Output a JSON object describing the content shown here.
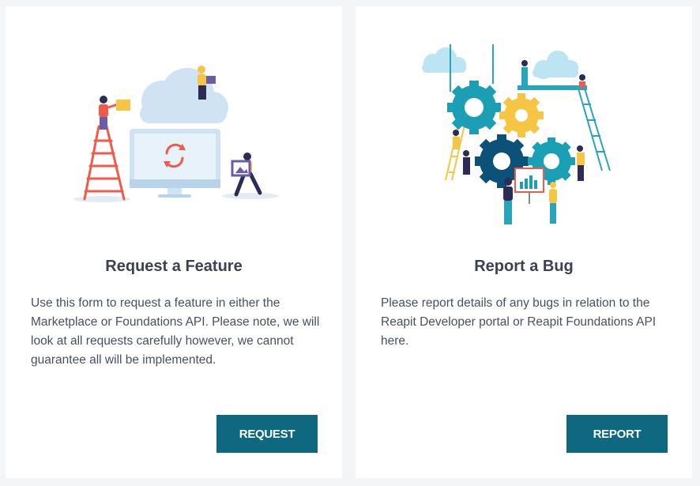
{
  "cards": [
    {
      "title": "Request a Feature",
      "description": "Use this form to request a feature in either the Marketplace or Foundations API. Please note, we will look at all requests carefully however, we cannot guarantee all will be implemented.",
      "button_label": "REQUEST",
      "illustration": "cloud-sync-illustration"
    },
    {
      "title": "Report a Bug",
      "description": "Please report details of any bugs in relation to the Reapit Developer portal or Reapit Foundations API here.",
      "button_label": "REPORT",
      "illustration": "gears-teamwork-illustration"
    }
  ],
  "colors": {
    "button": "#0d6880",
    "background": "#f4f5f7",
    "card": "#ffffff",
    "title": "#3b4150",
    "text": "#48505e"
  }
}
